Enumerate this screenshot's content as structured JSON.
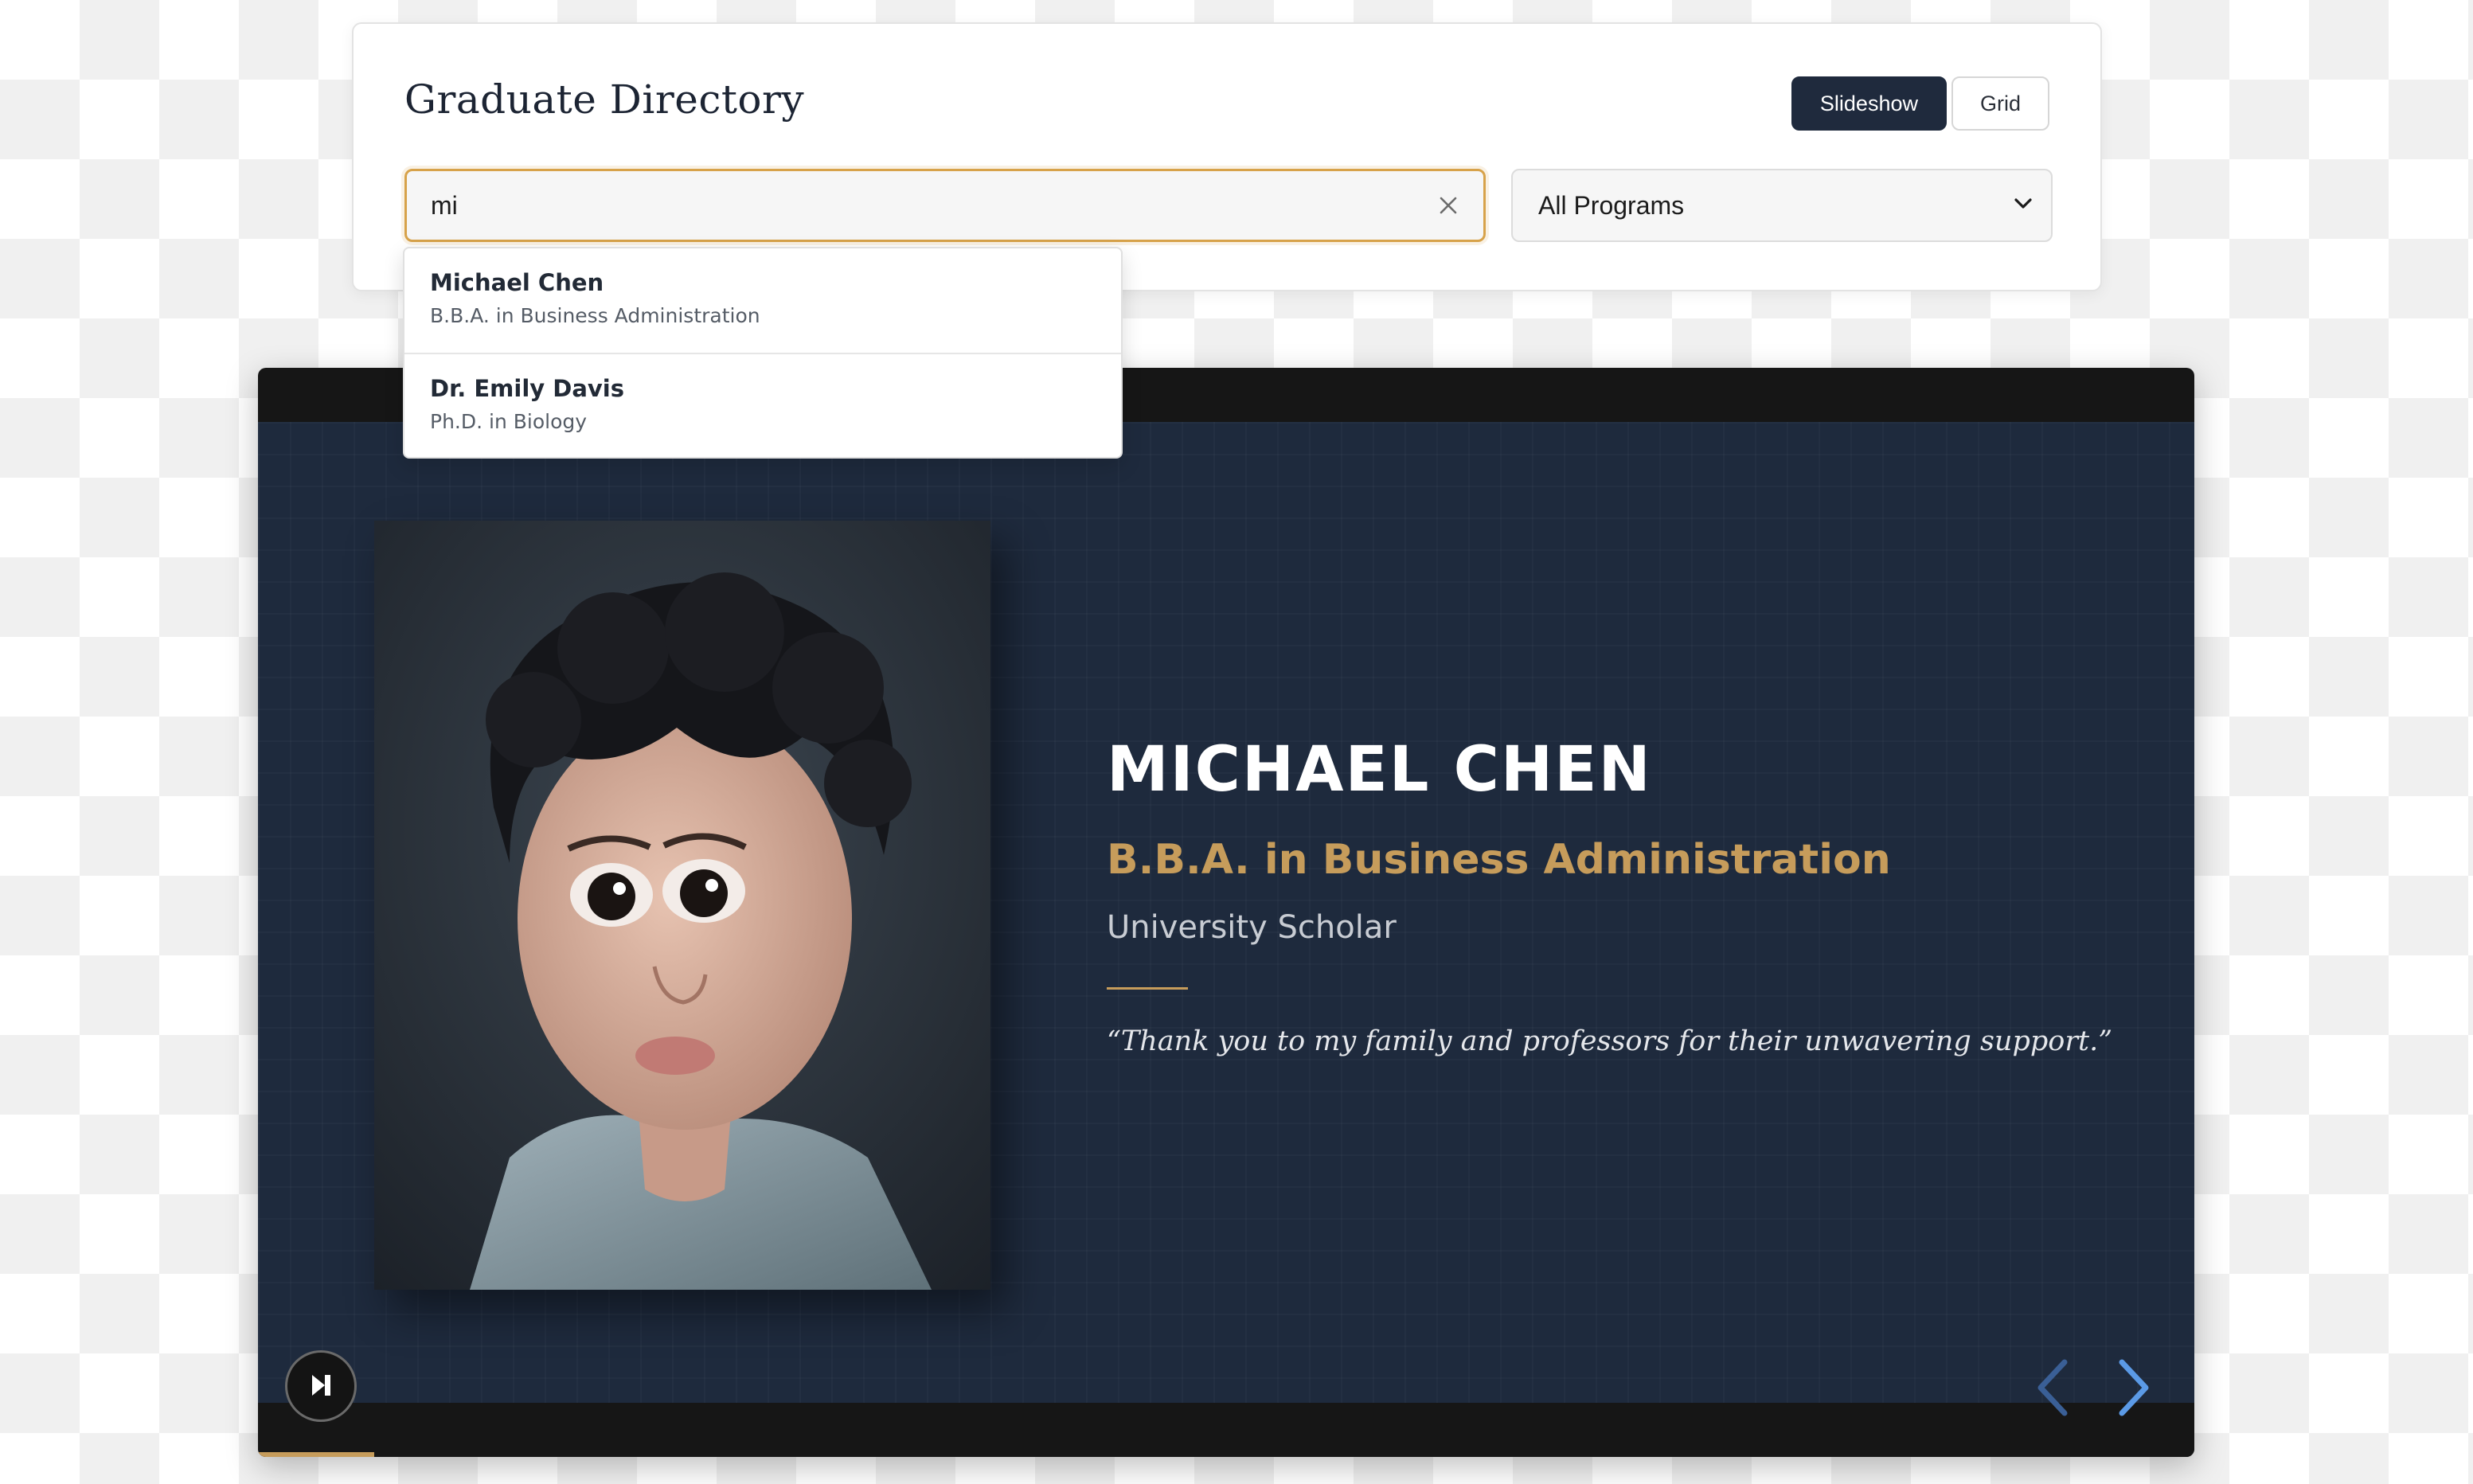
{
  "header": {
    "title": "Graduate Directory",
    "view_toggle": {
      "slideshow_label": "Slideshow",
      "grid_label": "Grid",
      "active": "Slideshow"
    }
  },
  "search": {
    "value": "mi",
    "clear_icon": "close-icon"
  },
  "program_filter": {
    "selected": "All Programs"
  },
  "suggestions": [
    {
      "name": "Michael Chen",
      "program": "B.B.A. in Business Administration"
    },
    {
      "name": "Dr. Emily Davis",
      "program": "Ph.D. in Biology"
    }
  ],
  "slide": {
    "name": "MICHAEL CHEN",
    "degree": "B.B.A. in Business Administration",
    "honor": "University Scholar",
    "quote": "“Thank you to my family and professors for their unwavering support.”",
    "photo": "portrait-photo"
  },
  "controls": {
    "play_icon": "play-pause-icon",
    "prev_icon": "chevron-left-icon",
    "next_icon": "chevron-right-icon",
    "progress": 0.06
  },
  "colors": {
    "accent_gold": "#c69c5b",
    "navy": "#1e2a3d",
    "dark_button": "#1f2a3d",
    "search_focus": "#d7a24a",
    "nav_prev": "#3a5f96",
    "nav_next": "#5b9ae6"
  }
}
